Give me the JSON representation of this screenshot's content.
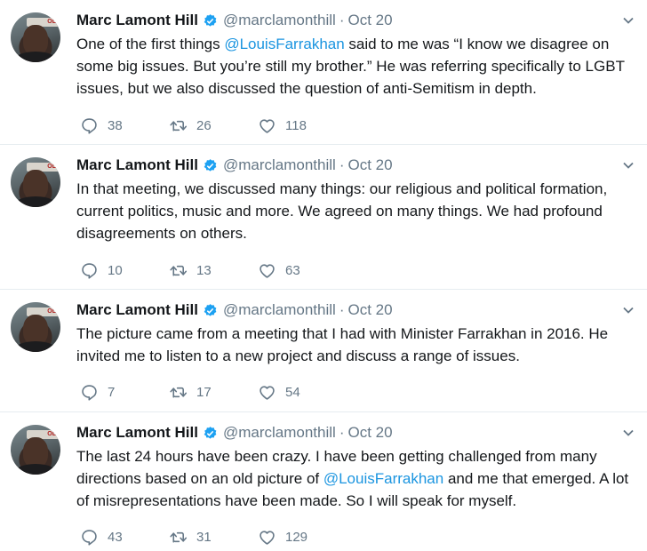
{
  "author": {
    "name": "Marc Lamont Hill",
    "handle": "@marclamonthill",
    "separator": "·",
    "avatar_banner_text": "OL"
  },
  "colors": {
    "link": "#1b95e0",
    "muted": "#657786",
    "verified": "#1da1f2"
  },
  "icons": {
    "verified": "verified-badge-icon",
    "menu": "chevron-down-icon",
    "reply": "reply-icon",
    "retweet": "retweet-icon",
    "like": "heart-icon"
  },
  "tweets": [
    {
      "date": "Oct 20",
      "text_parts": [
        "One of the first things ",
        "@LouisFarrakhan",
        " said to me was “I know we disagree on some big issues. But you’re still my brother.” He was referring specifically to LGBT issues, but we also discussed the question of anti-Semitism in depth."
      ],
      "replies": "38",
      "retweets": "26",
      "likes": "118"
    },
    {
      "date": "Oct 20",
      "text_parts": [
        "In that meeting, we discussed many things: our religious and political formation, current politics, music and more. We agreed on many things. We had profound disagreements on others.",
        "",
        ""
      ],
      "replies": "10",
      "retweets": "13",
      "likes": "63"
    },
    {
      "date": "Oct 20",
      "text_parts": [
        "The picture came from a meeting that I had with Minister Farrakhan in 2016. He invited me to listen to a new project and discuss a range of issues.",
        "",
        ""
      ],
      "replies": "7",
      "retweets": "17",
      "likes": "54"
    },
    {
      "date": "Oct 20",
      "text_parts": [
        "The last 24 hours have been crazy. I have been getting challenged from many directions based on an old picture of ",
        "@LouisFarrakhan",
        " and me that emerged. A lot of misrepresentations have been made. So I will speak for myself."
      ],
      "replies": "43",
      "retweets": "31",
      "likes": "129"
    }
  ]
}
